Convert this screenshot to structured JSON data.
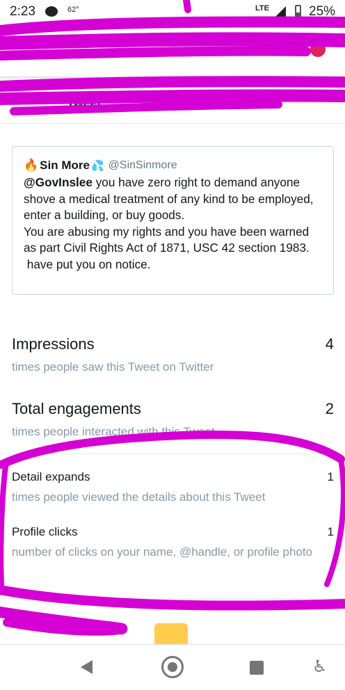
{
  "status_bar": {
    "time": "2:23",
    "temperature": "62°",
    "network": "LTE",
    "battery": "25%"
  },
  "header": {
    "title": "Tweet"
  },
  "tweet": {
    "author_name": "Sin More",
    "author_handle": "@SinSinmore",
    "mention": "@GovInslee",
    "text": " you have zero right to demand anyone shove a medical treatment of any kind to be employed, enter a building, or buy goods.\nYou are abusing my rights and you have been warned as part Civil Rights Act of 1871, USC 42 section 1983.\n have put you on notice."
  },
  "metrics": [
    {
      "label": "Impressions",
      "value": "4",
      "description": "times people saw this Tweet on Twitter"
    },
    {
      "label": "Total engagements",
      "value": "2",
      "description": "times people interacted with this Tweet"
    },
    {
      "label": "Detail expands",
      "value": "1",
      "description": "times people viewed the details about this Tweet"
    },
    {
      "label": "Profile clicks",
      "value": "1",
      "description": "number of clicks on your name, @handle, or profile photo"
    }
  ],
  "colors": {
    "scribble": "#d400d4",
    "secondary_text": "#8899a6",
    "card_border": "#ccd6dd"
  },
  "icons": [
    "message-icon",
    "signal-icon",
    "battery-icon",
    "fire-icon",
    "droplets-icon",
    "back-icon",
    "home-icon",
    "recents-icon",
    "accessibility-icon"
  ]
}
